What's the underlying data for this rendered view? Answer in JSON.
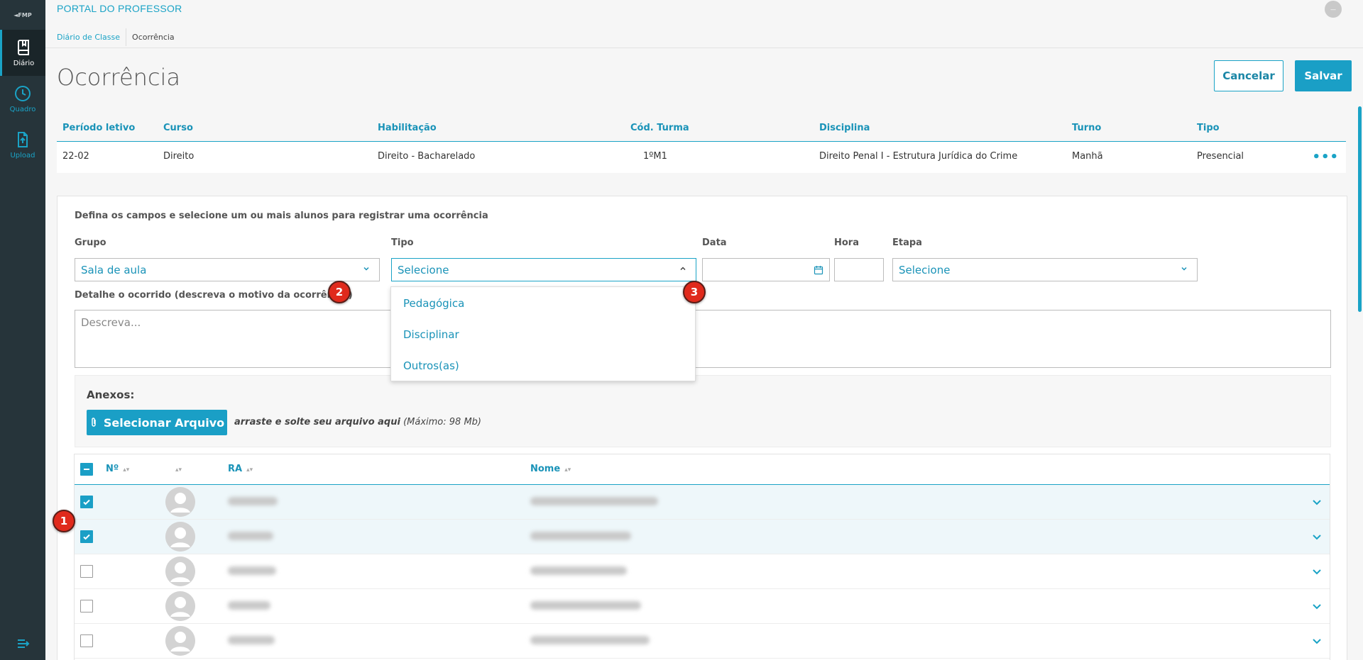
{
  "app": {
    "title": "PORTAL DO PROFESSOR",
    "logo": "FMP",
    "user_initials": "—"
  },
  "sidebar": {
    "items": [
      {
        "label": "Diário",
        "icon": "book-icon",
        "active": true
      },
      {
        "label": "Quadro",
        "icon": "clock-icon",
        "active": false
      },
      {
        "label": "Upload",
        "icon": "upload-icon",
        "active": false
      }
    ]
  },
  "breadcrumb": {
    "link": "Diário de Classe",
    "current": "Ocorrência"
  },
  "page": {
    "title": "Ocorrência",
    "cancel_label": "Cancelar",
    "save_label": "Salvar"
  },
  "class_info": {
    "headers": [
      "Período letivo",
      "Curso",
      "Habilitação",
      "Cód. Turma",
      "Disciplina",
      "Turno",
      "Tipo"
    ],
    "values": [
      "22-02",
      "Direito",
      "Direito - Bacharelado",
      "1ºM1",
      "Direito Penal I - Estrutura Jurídica do Crime",
      "Manhã",
      "Presencial"
    ]
  },
  "form": {
    "intro": "Defina os campos e selecione um ou mais alunos para registrar uma ocorrência",
    "grupo": {
      "label": "Grupo",
      "value": "Sala de aula"
    },
    "tipo": {
      "label": "Tipo",
      "value": "Selecione",
      "options": [
        "Pedagógica",
        "Disciplinar",
        "Outros(as)"
      ]
    },
    "data": {
      "label": "Data",
      "value": ""
    },
    "hora": {
      "label": "Hora",
      "value": ""
    },
    "etapa": {
      "label": "Etapa",
      "value": "Selecione"
    },
    "detalhe": {
      "label": "Detalhe o ocorrido (descreva o motivo da ocorrência)",
      "placeholder": "Descreva..."
    }
  },
  "attachments": {
    "title": "Anexos:",
    "button_label": "Selecionar Arquivo",
    "hint_bold": "arraste e solte seu arquivo aqui",
    "hint_rest": " (Máximo: 98 Mb)"
  },
  "students": {
    "headers": {
      "num": "Nº",
      "ra": "RA",
      "nome": "Nome"
    },
    "rows": [
      {
        "checked": true
      },
      {
        "checked": true
      },
      {
        "checked": false
      },
      {
        "checked": false
      },
      {
        "checked": false
      }
    ]
  },
  "annotations": [
    "1",
    "2",
    "3"
  ],
  "colors": {
    "accent": "#1aa3c6",
    "sidebar": "#26343a",
    "badge": "#e02a1c"
  }
}
